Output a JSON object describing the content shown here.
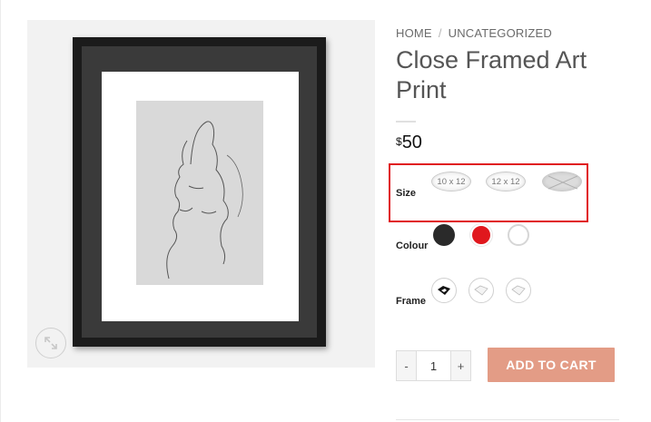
{
  "breadcrumb": {
    "home": "HOME",
    "separator": "/",
    "category": "UNCATEGORIZED"
  },
  "product": {
    "title": "Close Framed Art Print",
    "price_currency": "$",
    "price_amount": "50"
  },
  "attributes": {
    "size": {
      "label": "Size",
      "options": [
        {
          "label": "10 x 12",
          "available": true
        },
        {
          "label": "12 x 12",
          "available": true
        },
        {
          "label": "",
          "available": false
        }
      ]
    },
    "colour": {
      "label": "Colour",
      "options": [
        {
          "name": "black",
          "color": "#2a2a2a"
        },
        {
          "name": "red",
          "color": "#e0171d"
        },
        {
          "name": "white",
          "color": "#ffffff"
        }
      ]
    },
    "frame": {
      "label": "Frame",
      "options": [
        {
          "name": "black-frame",
          "color": "#1b1b1b"
        },
        {
          "name": "white-frame",
          "color": "#f2f2f2"
        },
        {
          "name": "white-frame-2",
          "color": "#f2f2f2"
        }
      ]
    }
  },
  "cart": {
    "quantity": "1",
    "minus": "-",
    "plus": "+",
    "add_label": "ADD TO CART",
    "button_color": "#e39c86"
  },
  "highlight_color": "#e0171d"
}
